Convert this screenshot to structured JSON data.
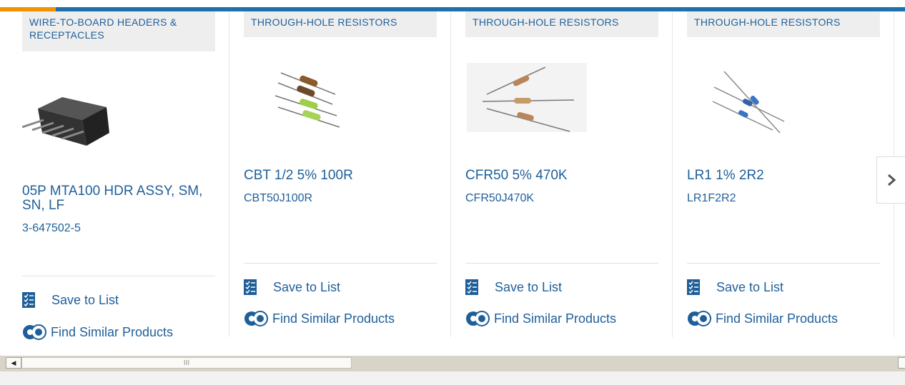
{
  "products": [
    {
      "category": "WIRE-TO-BOARD HEADERS & RECEPTACLES",
      "title": "05P MTA100 HDR ASSY, SM, SN, LF",
      "part_number": "3-647502-5",
      "image_icon": "connector-header-image",
      "save_label": "Save to List",
      "similar_label": "Find Similar Products"
    },
    {
      "category": "THROUGH-HOLE RESISTORS",
      "title": "CBT 1/2 5% 100R",
      "part_number": "CBT50J100R",
      "image_icon": "resistors-image",
      "save_label": "Save to List",
      "similar_label": "Find Similar Products"
    },
    {
      "category": "THROUGH-HOLE RESISTORS",
      "title": "CFR50 5% 470K",
      "part_number": "CFR50J470K",
      "image_icon": "resistors-image",
      "save_label": "Save to List",
      "similar_label": "Find Similar Products"
    },
    {
      "category": "THROUGH-HOLE RESISTORS",
      "title": "LR1 1% 2R2",
      "part_number": "LR1F2R2",
      "image_icon": "resistors-image",
      "save_label": "Save to List",
      "similar_label": "Find Similar Products"
    }
  ],
  "carousel": {
    "next_icon": "chevron-right-icon"
  },
  "scrollbar": {
    "left_arrow": "◀",
    "grip": "III"
  },
  "colors": {
    "link": "#1f5f99",
    "brand_bar": "#1d71ae",
    "accent": "#f39200",
    "category_bg": "#eeeeee"
  }
}
